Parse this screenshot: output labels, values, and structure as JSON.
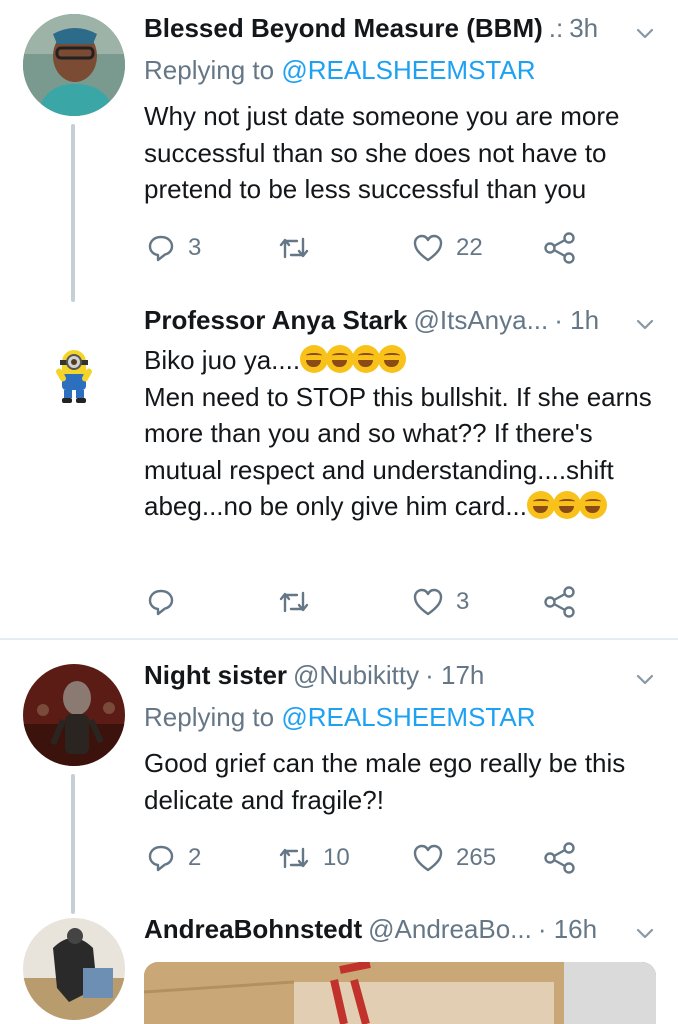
{
  "tweets": [
    {
      "name": "Blessed Beyond Measure (BBM)",
      "handle": ".:",
      "time": "3h",
      "replying_prefix": "Replying to ",
      "replying_to": "@REALSHEEMSTAR",
      "text": "Why not just date someone you are more successful than so she does not have to pretend to be less successful than you",
      "replies": "3",
      "retweets": "",
      "likes": "22"
    },
    {
      "name": "Professor Anya Stark",
      "handle": "@ItsAnya...",
      "time": "· 1h",
      "text_line1": "Biko juo ya....",
      "text_main": "Men need to STOP this bullshit. If she earns more than you and so what?? If there's mutual respect and understanding....shift abeg...no be only give him card...",
      "replies": "",
      "retweets": "",
      "likes": "3"
    },
    {
      "name": "Night sister",
      "handle": "@Nubikitty",
      "time": "· 17h",
      "replying_prefix": "Replying to ",
      "replying_to": "@REALSHEEMSTAR",
      "text": "Good grief can the male ego really be this delicate and fragile?!",
      "replies": "2",
      "retweets": "10",
      "likes": "265"
    },
    {
      "name": "AndreaBohnstedt",
      "handle": "@AndreaBo...",
      "time": "· 16h"
    }
  ],
  "colors": {
    "link": "#1da1f2",
    "secondary": "#657786",
    "thread_line": "#c4cfd6",
    "divider": "#e6ecf0"
  },
  "icons": [
    "reply-icon",
    "retweet-icon",
    "like-icon",
    "share-icon",
    "chevron-down-icon"
  ]
}
